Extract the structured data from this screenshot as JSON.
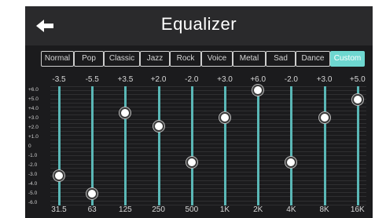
{
  "header": {
    "title": "Equalizer",
    "back_icon": "arrow-left-icon"
  },
  "presets": [
    {
      "label": "Normal",
      "active": false
    },
    {
      "label": "Pop",
      "active": false
    },
    {
      "label": "Classic",
      "active": false
    },
    {
      "label": "Jazz",
      "active": false
    },
    {
      "label": "Rock",
      "active": false
    },
    {
      "label": "Voice",
      "active": false
    },
    {
      "label": "Metal",
      "active": false
    },
    {
      "label": "Sad",
      "active": false
    },
    {
      "label": "Dance",
      "active": false
    },
    {
      "label": "Custom",
      "active": true
    }
  ],
  "scale": [
    "+6.0",
    "+5.0",
    "+4.0",
    "+3.0",
    "+2.0",
    "+1.0",
    "0",
    "-1.0",
    "-2.0",
    "-3.0",
    "-4.0",
    "-5.0",
    "-6.0"
  ],
  "bands": [
    {
      "freq": "31.5",
      "value_label": "-3.5",
      "value": -3.5
    },
    {
      "freq": "63",
      "value_label": "-5.5",
      "value": -5.5
    },
    {
      "freq": "125",
      "value_label": "+3.5",
      "value": 3.5
    },
    {
      "freq": "250",
      "value_label": "+2.0",
      "value": 2.0
    },
    {
      "freq": "500",
      "value_label": "-2.0",
      "value": -2.0
    },
    {
      "freq": "1K",
      "value_label": "+3.0",
      "value": 3.0
    },
    {
      "freq": "2K",
      "value_label": "+6.0",
      "value": 6.0
    },
    {
      "freq": "4K",
      "value_label": "-2.0",
      "value": -2.0
    },
    {
      "freq": "8K",
      "value_label": "+3.0",
      "value": 3.0
    },
    {
      "freq": "16K",
      "value_label": "+5.0",
      "value": 5.0
    }
  ],
  "colors": {
    "accent": "#6ed7d0",
    "track": "#5ab7b6",
    "background": "#1b1b1d",
    "header": "#2a2a2c"
  }
}
